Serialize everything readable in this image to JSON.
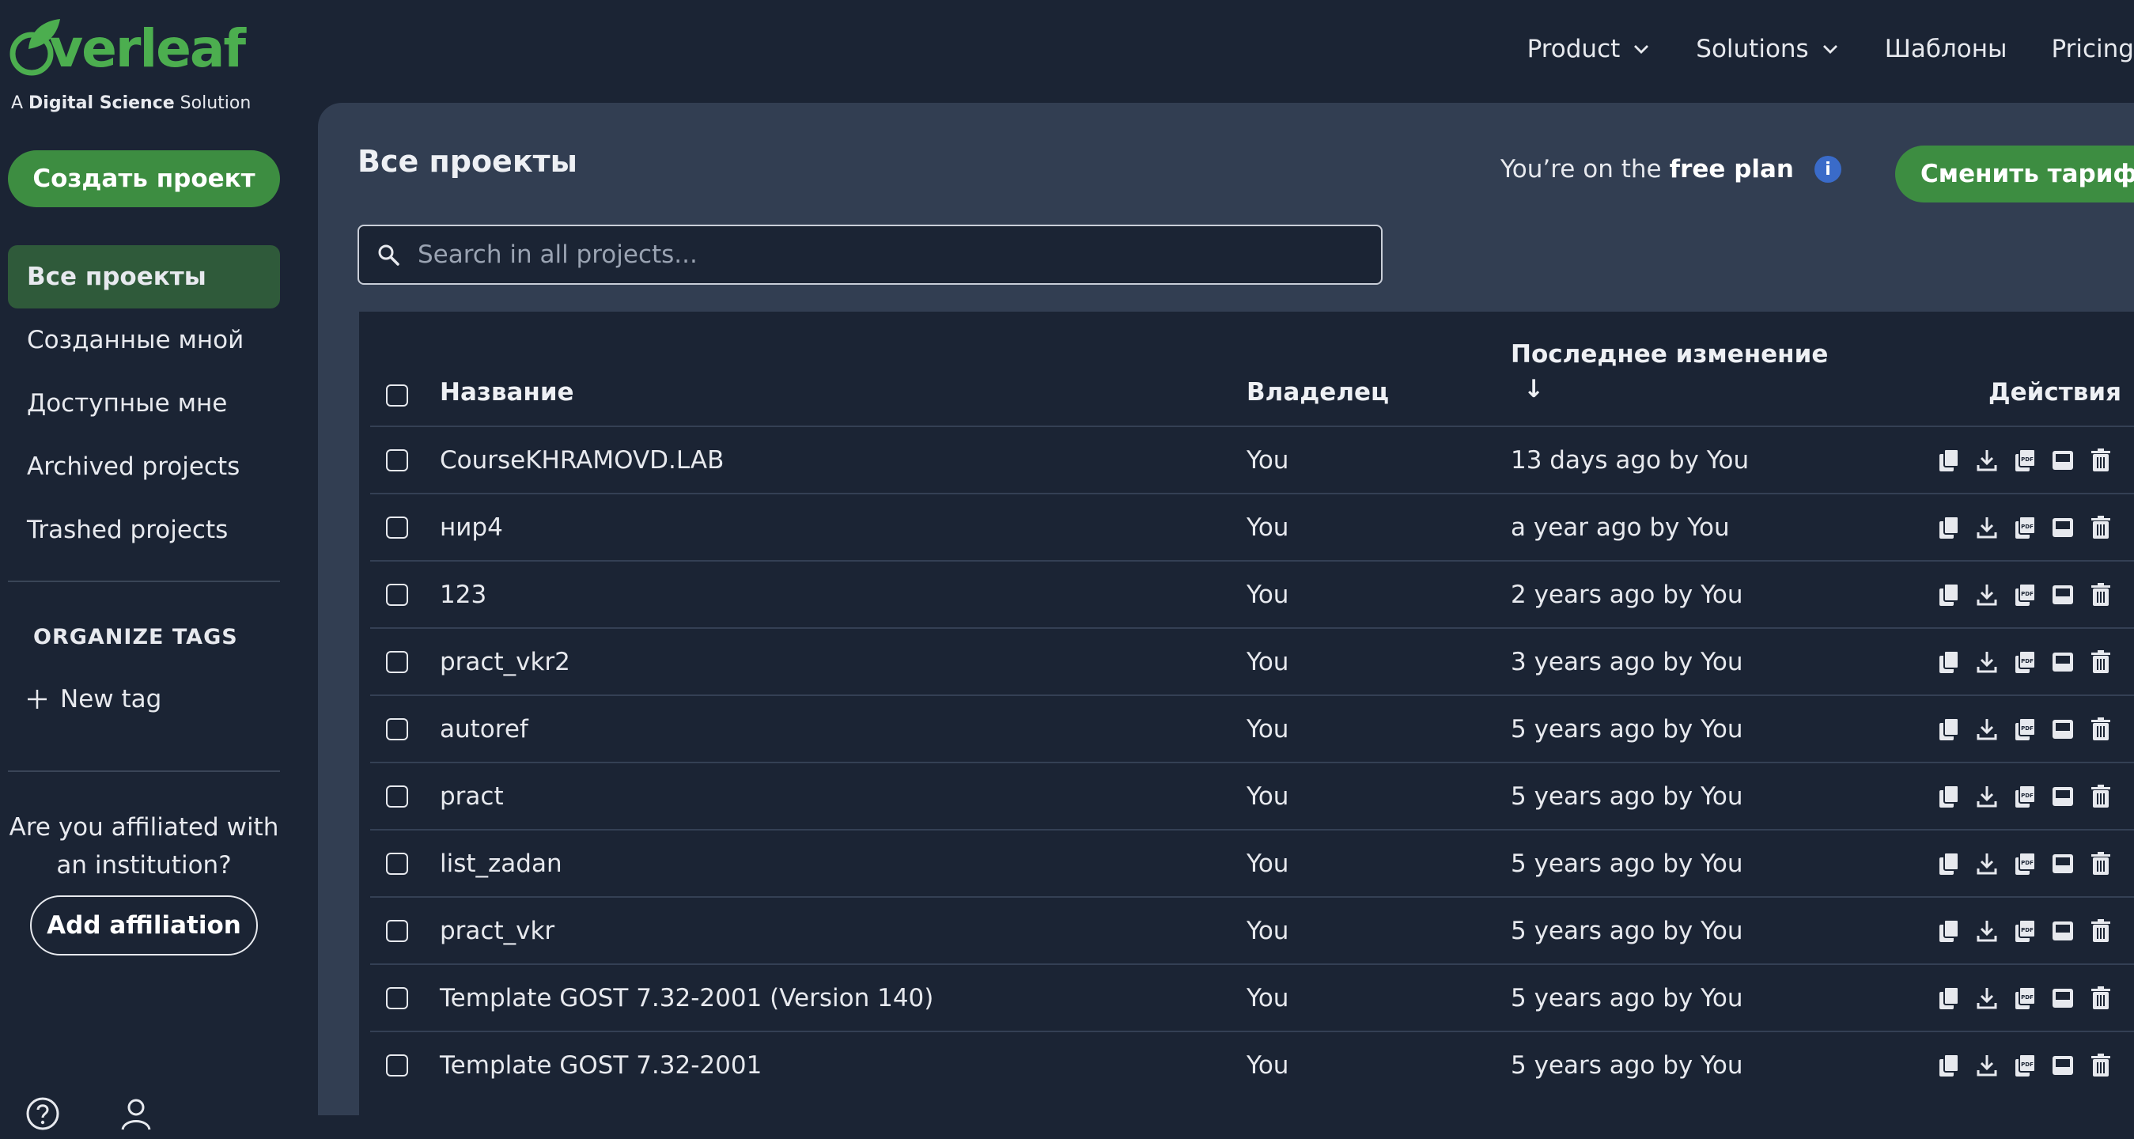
{
  "brand": {
    "logo_text": "Overleaf",
    "sub_prefix": "A ",
    "sub_bold": "Digital Science",
    "sub_suffix": " Solution",
    "accent": "#4cae4f"
  },
  "nav": [
    {
      "label": "Product",
      "has_dropdown": true
    },
    {
      "label": "Solutions",
      "has_dropdown": true
    },
    {
      "label": "Шаблоны",
      "has_dropdown": false
    },
    {
      "label": "Pricing",
      "has_dropdown": false
    }
  ],
  "sidebar": {
    "create_label": "Создать проект",
    "items": [
      {
        "label": "Все проекты",
        "active": true
      },
      {
        "label": "Созданные мной",
        "active": false
      },
      {
        "label": "Доступные мне",
        "active": false
      },
      {
        "label": "Archived projects",
        "active": false
      },
      {
        "label": "Trashed projects",
        "active": false
      }
    ],
    "tags_heading": "ORGANIZE TAGS",
    "new_tag_label": "New tag",
    "affiliation_question": "Are you affiliated with an institution?",
    "affiliation_button": "Add affiliation",
    "footer_icons": [
      "help-icon",
      "user-icon"
    ]
  },
  "main": {
    "title": "Все проекты",
    "plan_prefix": "You’re on the ",
    "plan_bold": "free plan",
    "info_glyph": "i",
    "upgrade_label": "Сменить тариф",
    "search_placeholder": "Search in all projects...",
    "columns": {
      "name": "Название",
      "owner": "Владелец",
      "modified": "Последнее изменение",
      "sort_arrow": "↓",
      "actions": "Действия"
    },
    "action_icons": [
      "copy-icon",
      "download-icon",
      "pdf-icon",
      "archive-icon",
      "trash-icon"
    ],
    "rows": [
      {
        "name": "CourseKHRAMOVD.LAB",
        "owner": "You",
        "modified": "13 days ago by You"
      },
      {
        "name": "нир4",
        "owner": "You",
        "modified": "a year ago by You"
      },
      {
        "name": "123",
        "owner": "You",
        "modified": "2 years ago by You"
      },
      {
        "name": "pract_vkr2",
        "owner": "You",
        "modified": "3 years ago by You"
      },
      {
        "name": "autoref",
        "owner": "You",
        "modified": "5 years ago by You"
      },
      {
        "name": "pract",
        "owner": "You",
        "modified": "5 years ago by You"
      },
      {
        "name": "list_zadan",
        "owner": "You",
        "modified": "5 years ago by You"
      },
      {
        "name": "pract_vkr",
        "owner": "You",
        "modified": "5 years ago by You"
      },
      {
        "name": "Template GOST 7.32-2001 (Version 140)",
        "owner": "You",
        "modified": "5 years ago by You"
      },
      {
        "name": "Template GOST 7.32-2001",
        "owner": "You",
        "modified": "5 years ago by You"
      }
    ]
  }
}
